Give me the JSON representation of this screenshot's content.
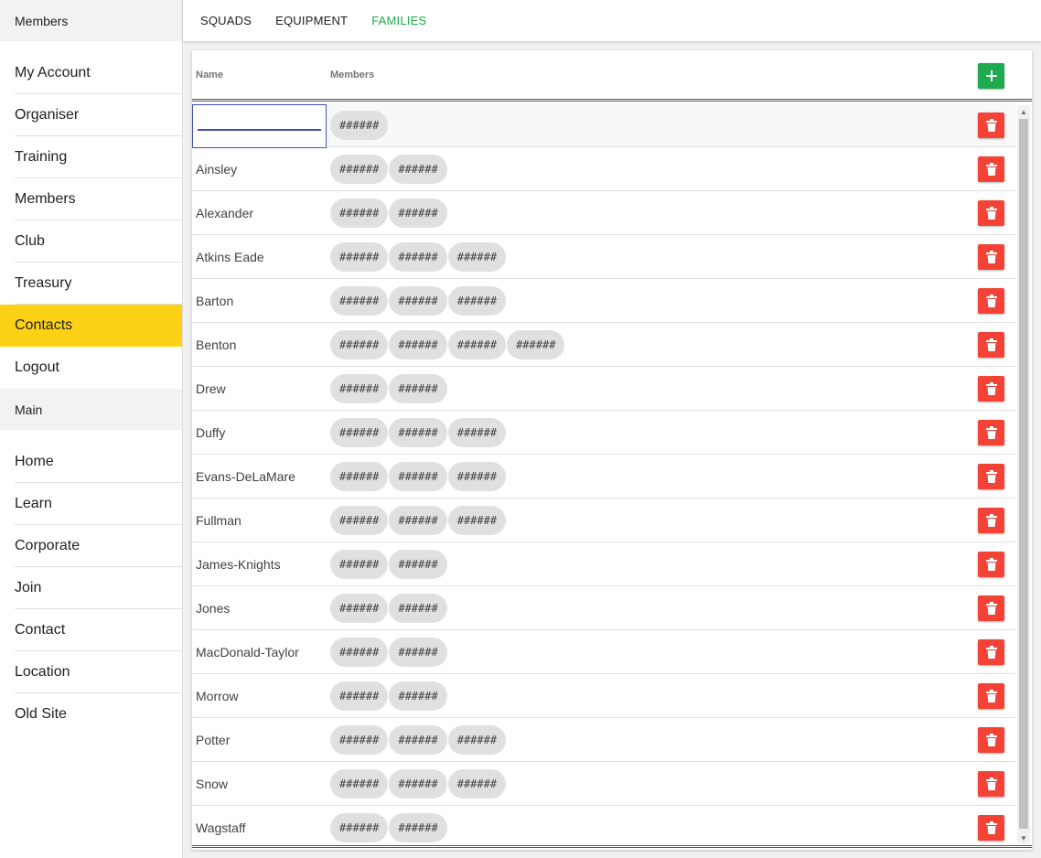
{
  "sidebar": {
    "section1_title": "Members",
    "section1_items": [
      {
        "label": "My Account"
      },
      {
        "label": "Organiser"
      },
      {
        "label": "Training"
      },
      {
        "label": "Members"
      },
      {
        "label": "Club"
      },
      {
        "label": "Treasury"
      },
      {
        "label": "Contacts",
        "active": true
      },
      {
        "label": "Logout"
      }
    ],
    "section2_title": "Main",
    "section2_items": [
      {
        "label": "Home"
      },
      {
        "label": "Learn"
      },
      {
        "label": "Corporate"
      },
      {
        "label": "Join"
      },
      {
        "label": "Contact"
      },
      {
        "label": "Location"
      },
      {
        "label": "Old Site"
      }
    ]
  },
  "tabs": [
    {
      "label": "SQUADS"
    },
    {
      "label": "EQUIPMENT"
    },
    {
      "label": "FAMILIES",
      "active": true
    }
  ],
  "table": {
    "headers": {
      "name": "Name",
      "members": "Members"
    },
    "add_icon": "plus-icon",
    "delete_icon": "trash-icon",
    "rows": [
      {
        "name": "",
        "editing": true,
        "members": [
          "######"
        ]
      },
      {
        "name": "Ainsley",
        "members": [
          "######",
          "######"
        ]
      },
      {
        "name": "Alexander",
        "members": [
          "######",
          "######"
        ]
      },
      {
        "name": "Atkins Eade",
        "members": [
          "######",
          "######",
          "######"
        ]
      },
      {
        "name": "Barton",
        "members": [
          "######",
          "######",
          "######"
        ]
      },
      {
        "name": "Benton",
        "members": [
          "######",
          "######",
          "######",
          "######"
        ]
      },
      {
        "name": "Drew",
        "members": [
          "######",
          "######"
        ]
      },
      {
        "name": "Duffy",
        "members": [
          "######",
          "######",
          "######"
        ]
      },
      {
        "name": "Evans-DeLaMare",
        "members": [
          "######",
          "######",
          "######"
        ]
      },
      {
        "name": "Fullman",
        "members": [
          "######",
          "######",
          "######"
        ]
      },
      {
        "name": "James-Knights",
        "members": [
          "######",
          "######"
        ]
      },
      {
        "name": "Jones",
        "members": [
          "######",
          "######"
        ]
      },
      {
        "name": "MacDonald-Taylor",
        "members": [
          "######",
          "######"
        ]
      },
      {
        "name": "Morrow",
        "members": [
          "######",
          "######"
        ]
      },
      {
        "name": "Potter",
        "members": [
          "######",
          "######",
          "######"
        ]
      },
      {
        "name": "Snow",
        "members": [
          "######",
          "######",
          "######"
        ]
      },
      {
        "name": "Wagstaff",
        "members": [
          "######",
          "######"
        ]
      }
    ]
  },
  "colors": {
    "accent_yellow": "#fdd216",
    "tab_active_green": "#1eaa4e",
    "add_button_green": "#1eaa4e",
    "delete_button_red": "#f44336",
    "input_focus_blue": "#3f51b5"
  }
}
